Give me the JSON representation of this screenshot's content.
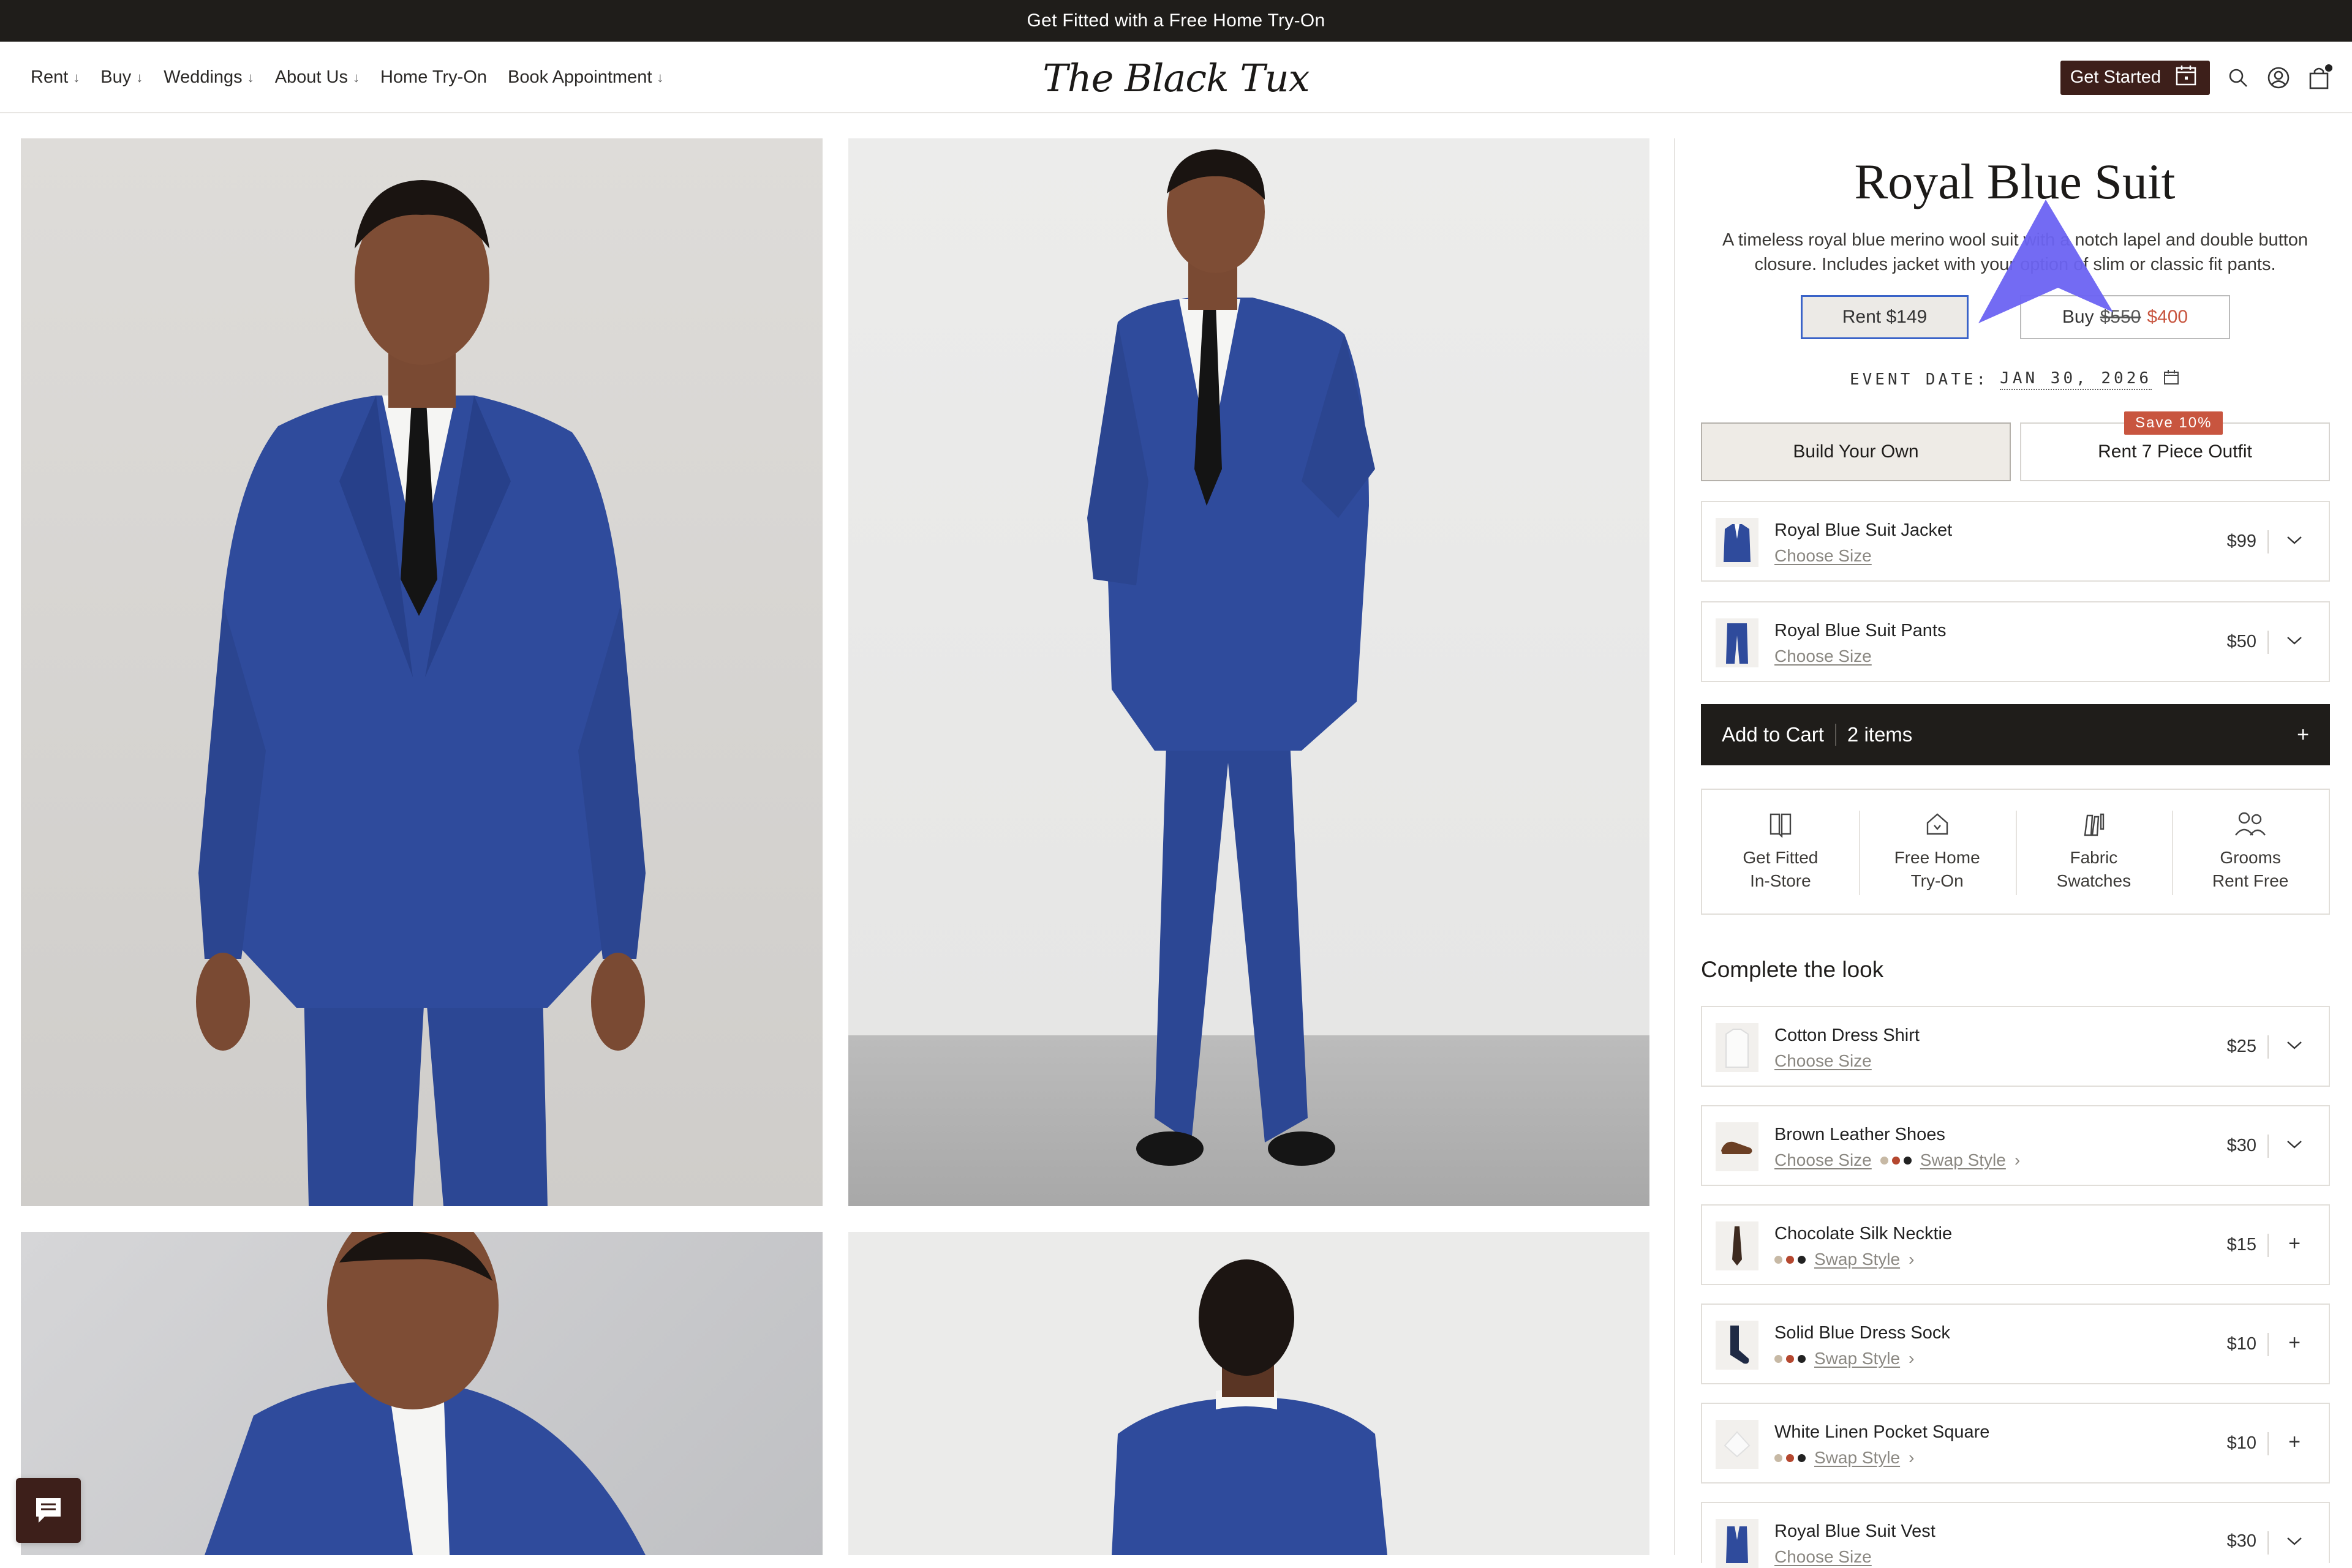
{
  "announcement": "Get Fitted with a Free Home Try-On",
  "nav": [
    {
      "label": "Rent",
      "dropdown": true
    },
    {
      "label": "Buy",
      "dropdown": true
    },
    {
      "label": "Weddings",
      "dropdown": true
    },
    {
      "label": "About Us",
      "dropdown": true
    },
    {
      "label": "Home Try-On",
      "dropdown": false
    },
    {
      "label": "Book Appointment",
      "dropdown": true
    }
  ],
  "logo": "The Black Tux",
  "header": {
    "get_started": "Get Started",
    "cart_badge": true
  },
  "product": {
    "title": "Royal Blue Suit",
    "description": "A timeless royal blue merino wool suit with a notch lapel and double button closure. Includes jacket with your option of slim or classic fit pants.",
    "rent_label": "Rent $149",
    "buy_prefix": "Buy",
    "buy_original": "$550",
    "buy_sale": "$400",
    "event_label": "EVENT DATE:",
    "event_date": "JAN 30, 2026",
    "build_own": "Build Your Own",
    "rent7": "Rent 7 Piece Outfit",
    "save_badge": "Save 10%"
  },
  "outfit_items": [
    {
      "name": "Royal Blue Suit Jacket",
      "sub": "Choose Size",
      "price": "$99",
      "control": "chevron"
    },
    {
      "name": "Royal Blue Suit Pants",
      "sub": "Choose Size",
      "price": "$50",
      "control": "chevron"
    }
  ],
  "cart": {
    "label": "Add to Cart",
    "count": "2 items",
    "plus": "+"
  },
  "perks": [
    {
      "line1": "Get Fitted",
      "line2": "In-Store",
      "icon": "store-icon"
    },
    {
      "line1": "Free Home",
      "line2": "Try-On",
      "icon": "home-icon"
    },
    {
      "line1": "Fabric",
      "line2": "Swatches",
      "icon": "swatches-icon"
    },
    {
      "line1": "Grooms",
      "line2": "Rent Free",
      "icon": "grooms-icon"
    }
  ],
  "look_heading": "Complete the look",
  "look_items": [
    {
      "name": "Cotton Dress Shirt",
      "size": "Choose Size",
      "swap": "",
      "price": "$25",
      "control": "chevron"
    },
    {
      "name": "Brown Leather Shoes",
      "size": "Choose Size",
      "swap": "Swap Style",
      "price": "$30",
      "control": "chevron"
    },
    {
      "name": "Chocolate Silk Necktie",
      "size": "",
      "swap": "Swap Style",
      "price": "$15",
      "control": "plus"
    },
    {
      "name": "Solid Blue Dress Sock",
      "size": "",
      "swap": "Swap Style",
      "price": "$10",
      "control": "plus"
    },
    {
      "name": "White Linen Pocket Square",
      "size": "",
      "swap": "Swap Style",
      "price": "$10",
      "control": "plus"
    },
    {
      "name": "Royal Blue Suit Vest",
      "size": "Choose Size",
      "swap": "",
      "price": "$30",
      "control": "chevron"
    }
  ],
  "colors": {
    "suit_blue": "#2e4a9a",
    "accent_red": "#c8553f",
    "dark": "#1f1d1a",
    "brand_brown": "#3d1f1a"
  }
}
